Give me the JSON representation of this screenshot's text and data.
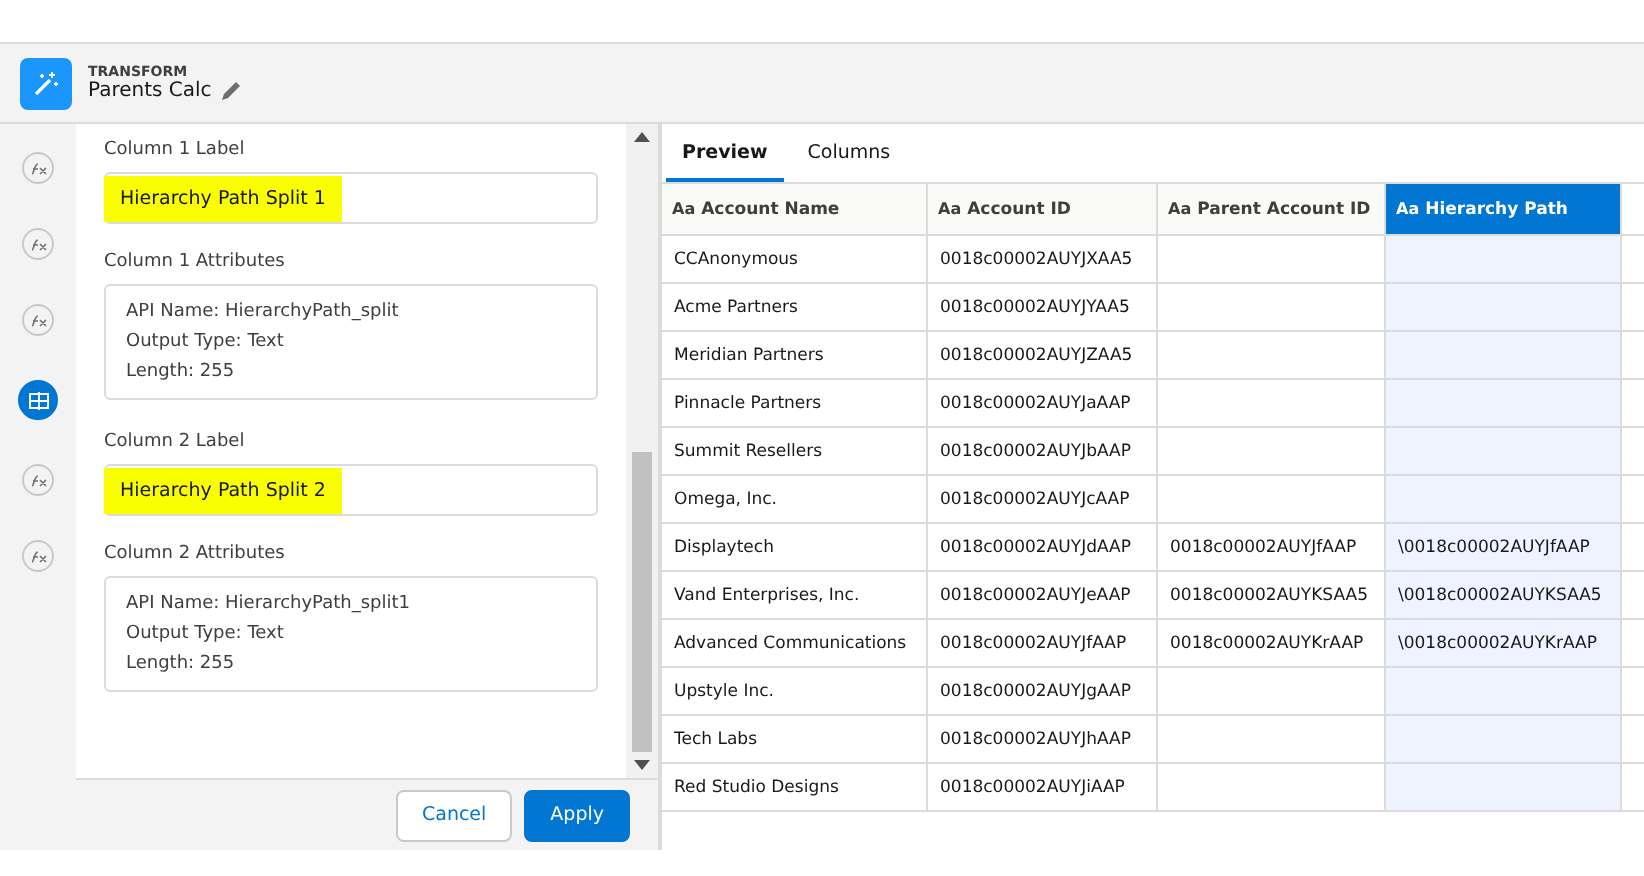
{
  "header": {
    "kind_label": "TRANSFORM",
    "title": "Parents Calc"
  },
  "steps": [
    {
      "kind": "formula",
      "selected": false
    },
    {
      "kind": "formula",
      "selected": false
    },
    {
      "kind": "formula",
      "selected": false
    },
    {
      "kind": "split",
      "selected": true
    },
    {
      "kind": "formula",
      "selected": false
    },
    {
      "kind": "formula",
      "selected": false
    }
  ],
  "form": {
    "sections": [
      {
        "label": "Column 1 Label",
        "value": "Hierarchy Path Split 1",
        "highlighted": true,
        "attributes_label": "Column 1 Attributes",
        "attributes": [
          "API Name: HierarchyPath_split",
          "Output Type: Text",
          "Length: 255"
        ]
      },
      {
        "label": "Column 2 Label",
        "value": "Hierarchy Path Split 2",
        "highlighted": true,
        "attributes_label": "Column 2 Attributes",
        "attributes": [
          "API Name: HierarchyPath_split1",
          "Output Type: Text",
          "Length: 255"
        ]
      }
    ],
    "buttons": [
      {
        "label": "Cancel",
        "kind": "neutral"
      },
      {
        "label": "Apply",
        "kind": "brand"
      }
    ]
  },
  "tabs": [
    {
      "label": "Preview",
      "selected": true
    },
    {
      "label": "Columns",
      "selected": false
    }
  ],
  "table": {
    "columns": [
      {
        "label": "Account Name",
        "type_icon": "Aa",
        "selected": false
      },
      {
        "label": "Account ID",
        "type_icon": "Aa",
        "selected": false
      },
      {
        "label": "Parent Account ID",
        "type_icon": "Aa",
        "selected": false
      },
      {
        "label": "Hierarchy Path",
        "type_icon": "Aa",
        "selected": true
      }
    ],
    "rows": [
      [
        "CCAnonymous",
        "0018c00002AUYJXAA5",
        "",
        ""
      ],
      [
        "Acme Partners",
        "0018c00002AUYJYAA5",
        "",
        ""
      ],
      [
        "Meridian Partners",
        "0018c00002AUYJZAA5",
        "",
        ""
      ],
      [
        "Pinnacle Partners",
        "0018c00002AUYJaAAP",
        "",
        ""
      ],
      [
        "Summit Resellers",
        "0018c00002AUYJbAAP",
        "",
        ""
      ],
      [
        "Omega, Inc.",
        "0018c00002AUYJcAAP",
        "",
        ""
      ],
      [
        "Displaytech",
        "0018c00002AUYJdAAP",
        "0018c00002AUYJfAAP",
        "\\0018c00002AUYJfAAP"
      ],
      [
        "Vand Enterprises, Inc.",
        "0018c00002AUYJeAAP",
        "0018c00002AUYKSAA5",
        "\\0018c00002AUYKSAA5"
      ],
      [
        "Advanced Communications",
        "0018c00002AUYJfAAP",
        "0018c00002AUYKrAAP",
        "\\0018c00002AUYKrAAP"
      ],
      [
        "Upstyle Inc.",
        "0018c00002AUYJgAAP",
        "",
        ""
      ],
      [
        "Tech Labs",
        "0018c00002AUYJhAAP",
        "",
        ""
      ],
      [
        "Red Studio Designs",
        "0018c00002AUYJiAAP",
        "",
        ""
      ]
    ]
  }
}
